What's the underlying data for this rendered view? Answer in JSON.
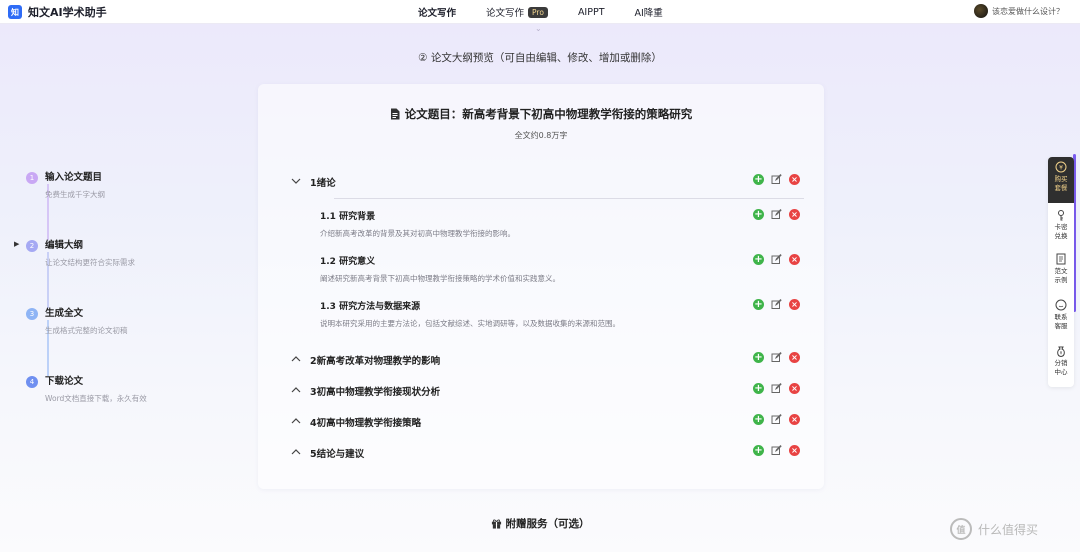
{
  "brand": {
    "logo_text": "知",
    "name": "知文AI学术助手"
  },
  "nav": {
    "items": [
      {
        "label": "论文写作",
        "active": true
      },
      {
        "label": "论文写作",
        "badge": "Pro",
        "active": false
      },
      {
        "label": "AIPPT",
        "active": false
      },
      {
        "label": "AI降重",
        "active": false
      }
    ]
  },
  "user": {
    "text": "该恋爱做什么设计？"
  },
  "section_heading": "② 论文大纲预览（可自由编辑、修改、增加或删除）",
  "steps": [
    {
      "num": "1",
      "title": "输入论文题目",
      "desc": "免费生成千字大纲",
      "color": "#c9a8f4"
    },
    {
      "num": "2",
      "title": "编辑大纲",
      "desc": "让论文结构更符合实际需求",
      "color": "#a5a9f3",
      "current": true
    },
    {
      "num": "3",
      "title": "生成全文",
      "desc": "生成格式完整的论文初稿",
      "color": "#8eb4f5"
    },
    {
      "num": "4",
      "title": "下载论文",
      "desc": "Word文档直接下载，永久有效",
      "color": "#6f8ff0"
    }
  ],
  "paper": {
    "title": "论文题目：新高考背景下初高中物理教学衔接的策略研究",
    "word_count": "全文约0.8万字"
  },
  "chapters": [
    {
      "title": "1绪论",
      "expanded": true
    },
    {
      "title": "2新高考改革对物理教学的影响",
      "expanded": false
    },
    {
      "title": "3初高中物理教学衔接现状分析",
      "expanded": false
    },
    {
      "title": "4初高中物理教学衔接策略",
      "expanded": false
    },
    {
      "title": "5结论与建议",
      "expanded": false
    }
  ],
  "subsections": [
    {
      "title": "1.1 研究背景",
      "desc": "介绍新高考改革的背景及其对初高中物理教学衔接的影响。"
    },
    {
      "title": "1.2 研究意义",
      "desc": "阐述研究新高考背景下初高中物理教学衔接策略的学术价值和实践意义。"
    },
    {
      "title": "1.3 研究方法与数据来源",
      "desc": "说明本研究采用的主要方法论，包括文献综述、实地调研等，以及数据收集的来源和范围。"
    }
  ],
  "gift_heading": "附赠服务（可选）",
  "side_panel": {
    "items": [
      {
        "label_1": "购买",
        "label_2": "套餐",
        "icon": "coin-icon"
      },
      {
        "label_1": "卡密",
        "label_2": "兑换",
        "icon": "key-icon"
      },
      {
        "label_1": "范文",
        "label_2": "示例",
        "icon": "document-icon"
      },
      {
        "label_1": "联系",
        "label_2": "客服",
        "icon": "chat-icon"
      },
      {
        "label_1": "分销",
        "label_2": "中心",
        "icon": "money-bag-icon"
      }
    ]
  },
  "watermark": {
    "logo": "值",
    "text": "什么值得买"
  },
  "colors": {
    "add": "#3fb44a",
    "delete": "#e84343",
    "accent": "#7a5cf0"
  }
}
